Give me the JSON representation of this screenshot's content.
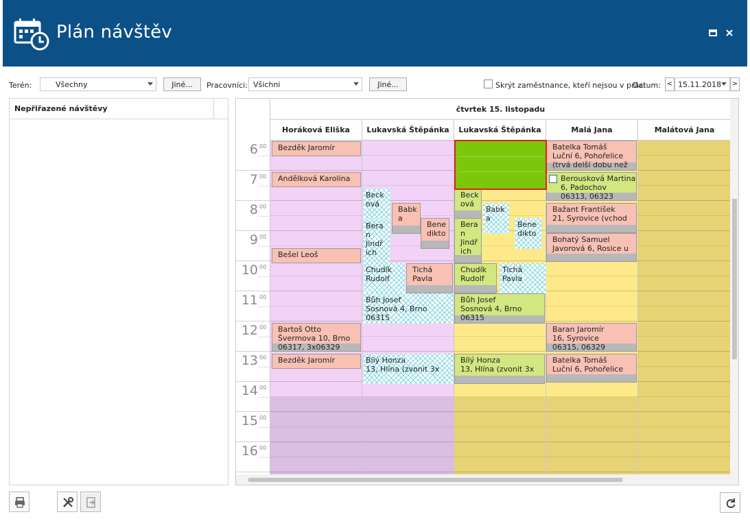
{
  "window": {
    "title": "Plán návštěv"
  },
  "toolbar": {
    "teren_label": "Terén:",
    "teren_value": "Všechny",
    "teren_other": "Jiné...",
    "pracovnici_label": "Pracovníci:",
    "pracovnici_value": "Všichni",
    "pracovnici_other": "Jiné...",
    "hide_label": "Skrýt zaměstnance, kteří nejsou v práci",
    "datum_label": "Datum:",
    "prev": "<",
    "date_value": "15.11.2018",
    "next": ">"
  },
  "left_panel": {
    "title": "Nepřiřazené návštěvy"
  },
  "scheduler": {
    "date_header": "čtvrtek 15. listopadu",
    "resources": [
      "Horáková Eliška",
      "Lukavská Štěpánka",
      "Lukavská Štěpánka",
      "Malá Jana",
      "Malátová Jana"
    ],
    "hours": [
      "6",
      "7",
      "8",
      "9",
      "10",
      "11",
      "12",
      "13",
      "14",
      "15",
      "16"
    ],
    "minutes": "00",
    "appointments": [
      {
        "col": 0,
        "style": "salmon",
        "lines": [
          "Bezděk Jaromír"
        ]
      },
      {
        "col": 0,
        "style": "salmon",
        "lines": [
          "Andělková Karolina"
        ]
      },
      {
        "col": 0,
        "style": "salmon",
        "lines": [
          "Bešel Leoš"
        ]
      },
      {
        "col": 0,
        "style": "salmon",
        "lines": [
          "Bartoš Otto",
          "Švermova 10, Brno",
          "06317, 3x06329"
        ]
      },
      {
        "col": 0,
        "style": "salmon",
        "lines": [
          "Bezděk Jaromír"
        ]
      },
      {
        "col": 1,
        "style": "hatch",
        "lines": [
          "Beck",
          "ová"
        ]
      },
      {
        "col": 1,
        "style": "salmon",
        "lines": [
          "Babk",
          "a"
        ]
      },
      {
        "col": 1,
        "style": "hatch",
        "lines": [
          "Bera",
          "n",
          "Jindř",
          "ich"
        ]
      },
      {
        "col": 1,
        "style": "salmon",
        "lines": [
          "Bene",
          "dikto"
        ]
      },
      {
        "col": 1,
        "style": "hatch",
        "lines": [
          "Chudík",
          "Rudolf"
        ]
      },
      {
        "col": 1,
        "style": "salmon",
        "lines": [
          "Tichá",
          "Pavla"
        ]
      },
      {
        "col": 1,
        "style": "hatch",
        "lines": [
          "Bůh Josef",
          "Sosnová 4, Brno",
          "06315"
        ]
      },
      {
        "col": 1,
        "style": "hatch",
        "lines": [
          "Bílý Honza",
          "13, Hlína (zvonit 3x"
        ]
      },
      {
        "col": 2,
        "style": "lime",
        "lines": [
          "Beck",
          "ová"
        ]
      },
      {
        "col": 2,
        "style": "hatch",
        "lines": [
          "Babk",
          "a"
        ]
      },
      {
        "col": 2,
        "style": "lime",
        "lines": [
          "Bera",
          "n",
          "Jindř",
          "ich"
        ]
      },
      {
        "col": 2,
        "style": "hatch",
        "lines": [
          "Bene",
          "dikto"
        ]
      },
      {
        "col": 2,
        "style": "lime",
        "lines": [
          "Chudík",
          "Rudolf"
        ]
      },
      {
        "col": 2,
        "style": "hatch",
        "lines": [
          "Tichá",
          "Pavla"
        ]
      },
      {
        "col": 2,
        "style": "lime",
        "lines": [
          "Bůh Josef",
          "Sosnová 4, Brno",
          "06315"
        ]
      },
      {
        "col": 2,
        "style": "lime",
        "lines": [
          "Bílý Honza",
          "13, Hlína (zvonit 3x"
        ]
      },
      {
        "col": 3,
        "style": "salmon",
        "lines": [
          "Batelka Tomáš",
          "Luční 6, Pohořelice",
          "(trvá delší dobu než"
        ]
      },
      {
        "col": 3,
        "style": "lime",
        "lines": [
          "Berousková Martina",
          "6, Padochov",
          "06313, 06323"
        ]
      },
      {
        "col": 3,
        "style": "salmon",
        "lines": [
          "Bažant František",
          "21, Syrovice (vchod"
        ]
      },
      {
        "col": 3,
        "style": "salmon",
        "lines": [
          "Bohatý Samuel",
          "Javorová 6, Rosice u"
        ]
      },
      {
        "col": 3,
        "style": "salmon",
        "lines": [
          "Baran Jaromír",
          "16, Syrovice",
          "06315, 06329"
        ]
      },
      {
        "col": 3,
        "style": "salmon",
        "lines": [
          "Batelka Tomáš",
          "Luční 6, Pohořelice"
        ]
      }
    ]
  },
  "icons": {
    "app": "calendar-clock-icon",
    "maximize": "maximize-icon",
    "close": "close-icon",
    "print": "print-icon",
    "tools": "tools-icon",
    "export": "export-icon",
    "refresh": "refresh-icon"
  },
  "colors": {
    "titlebar": "#0c5088",
    "pink_col": "#f2d2f6",
    "yellow_col": "#fde98a",
    "mustard_col": "#e6d376",
    "salmon_appt": "#f8c1b4",
    "lime_appt": "#d2e780",
    "selection": "#7cc70c",
    "selection_border": "#e02020"
  }
}
